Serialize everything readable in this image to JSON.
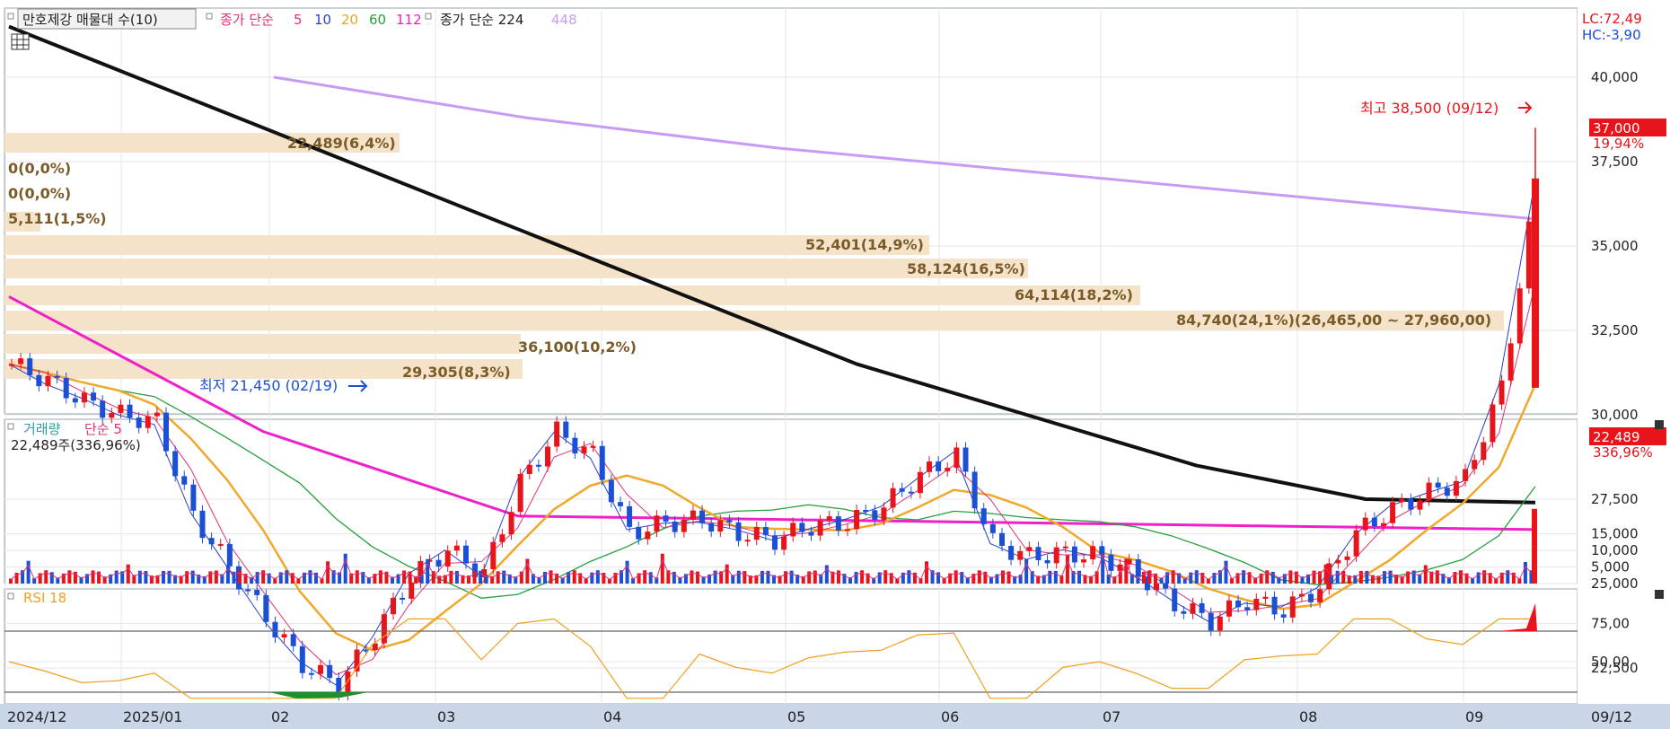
{
  "price_legend": {
    "title": "만호제강 매물대 수(10)",
    "ma_label": "종가 단순",
    "ma_periods": [
      "5",
      "10",
      "20",
      "60",
      "112"
    ],
    "ma_long_label": "종가 단순 224",
    "ma_long_extra": "448"
  },
  "indicators": {
    "lc": "LC:72,49",
    "hc": "HC:-3,90"
  },
  "price_axis": [
    "40,000",
    "37,500",
    "35,000",
    "32,500",
    "30,000",
    "27,500",
    "25,000",
    "22,500"
  ],
  "current_price": {
    "value": "37,000",
    "change": "19,94%"
  },
  "annotations": {
    "high": "최고 38,500 (09/12)",
    "low": "최저 21,450 (02/19)"
  },
  "volume_profile_labels": [
    "22,489(6,4%)",
    "0(0,0%)",
    "0(0,0%)",
    "5,111(1,5%)",
    "52,401(14,9%)",
    "58,124(16,5%)",
    "64,114(18,2%)",
    "84,740(24,1%)(26,465,00 ~ 27,960,00)",
    "36,100(10,2%)",
    "29,305(8,3%)"
  ],
  "volume_legend": {
    "label": "거래량",
    "ma": "단순 5",
    "current": "22,489주(336,96%)"
  },
  "volume_axis": [
    "15,000",
    "10,000",
    "5,000"
  ],
  "current_volume": {
    "value": "22,489",
    "change": "336,96%"
  },
  "rsi_legend": {
    "label": "RSI 18"
  },
  "rsi_axis": [
    "75,00",
    "50,00"
  ],
  "date_axis": [
    "2024/12",
    "2025/01",
    "02",
    "03",
    "04",
    "05",
    "06",
    "07",
    "08",
    "09"
  ],
  "date_end": "09/12",
  "colors": {
    "up": "#e8141b",
    "down": "#1a4fd6",
    "ma5": "#2a3fc9",
    "ma10": "#e0317a",
    "ma20": "#f0a82a",
    "ma60": "#23a03c",
    "ma112": "#f01fc9",
    "ma224": "#111111",
    "ma448": "#c79bf5",
    "profile": "#f5e3c9",
    "rsi": "#f0a020"
  },
  "chart_data": {
    "type": "candlestick",
    "title": "만호제강 매물대 수(10)",
    "ylim": [
      20500,
      42500
    ],
    "high": 38500,
    "low": 21450,
    "close": 37000,
    "x": [
      "2024/12",
      "2025/01",
      "02",
      "03",
      "04",
      "05",
      "06",
      "07",
      "08",
      "09",
      "09/12"
    ],
    "close_series": [
      31500,
      31000,
      30400,
      30000,
      29800,
      27000,
      25500,
      24000,
      22600,
      22000,
      23500,
      25200,
      26000,
      25300,
      28000,
      29500,
      28800,
      26500,
      26800,
      26900,
      26500,
      26300,
      26700,
      26800,
      27300,
      28200,
      28800,
      26200,
      25800,
      25900,
      25800,
      25300,
      24400,
      23900,
      24500,
      24200,
      24900,
      26500,
      27200,
      27700,
      28100,
      30800,
      37000
    ],
    "ma224": [
      41500,
      39500,
      37500,
      35500,
      33500,
      31500,
      30000,
      28500,
      27500,
      27400
    ],
    "ma448": [
      40000,
      38800,
      37900,
      37200,
      36500,
      35800
    ],
    "ma112": [
      33500,
      29500,
      27000,
      26900,
      26800,
      26700,
      26600
    ],
    "volume_profile": [
      6.4,
      0,
      0,
      1.5,
      14.9,
      16.5,
      18.2,
      24.1,
      10.2,
      8.3
    ],
    "volume_latest": 22489,
    "rsi_latest": 72.49,
    "rsi_levels": [
      70,
      30
    ]
  }
}
